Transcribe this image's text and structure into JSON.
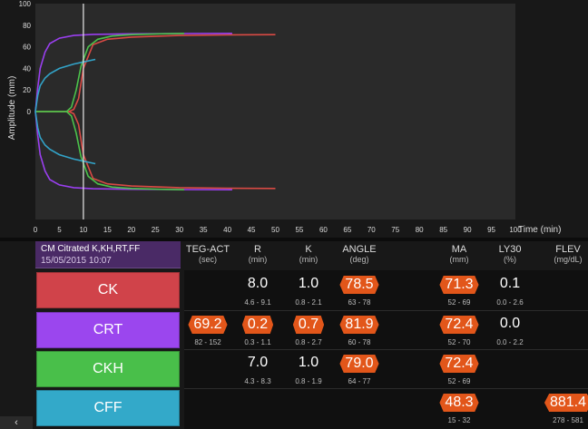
{
  "chart_data": {
    "type": "line",
    "xlabel": "Time (min)",
    "ylabel": "Amplitude (mm)",
    "xlim": [
      0,
      100
    ],
    "ylim": [
      -100,
      100
    ],
    "xticks": [
      0,
      5,
      10,
      15,
      20,
      25,
      30,
      35,
      40,
      45,
      50,
      55,
      60,
      65,
      70,
      75,
      80,
      85,
      90,
      95,
      100
    ],
    "yticks": [
      100,
      80,
      60,
      40,
      20,
      0
    ],
    "cursor_x": 10,
    "series": [
      {
        "color": "#d94a44",
        "points": [
          [
            0,
            0
          ],
          [
            7,
            0
          ],
          [
            8,
            2
          ],
          [
            9,
            12
          ],
          [
            10,
            40
          ],
          [
            12,
            62
          ],
          [
            15,
            67
          ],
          [
            20,
            69
          ],
          [
            30,
            70.5
          ],
          [
            40,
            71
          ],
          [
            50,
            71.3
          ]
        ]
      },
      {
        "color": "#9a3ff0",
        "points": [
          [
            0,
            0
          ],
          [
            0.5,
            22
          ],
          [
            1,
            40
          ],
          [
            2,
            55
          ],
          [
            3,
            63
          ],
          [
            5,
            68
          ],
          [
            8,
            70.5
          ],
          [
            12,
            71.5
          ],
          [
            20,
            72
          ],
          [
            30,
            72.3
          ],
          [
            41,
            72.4
          ]
        ]
      },
      {
        "color": "#4bc24b",
        "points": [
          [
            0,
            0
          ],
          [
            6.5,
            0
          ],
          [
            7.5,
            4
          ],
          [
            8.5,
            20
          ],
          [
            9.5,
            42
          ],
          [
            11,
            60
          ],
          [
            13,
            67
          ],
          [
            16,
            70
          ],
          [
            20,
            71.3
          ],
          [
            26,
            72
          ],
          [
            31,
            72.4
          ]
        ]
      },
      {
        "color": "#32a3c8",
        "points": [
          [
            0,
            0
          ],
          [
            0.5,
            15
          ],
          [
            1,
            24
          ],
          [
            2,
            31
          ],
          [
            3,
            35
          ],
          [
            5,
            40
          ],
          [
            8,
            44
          ],
          [
            10,
            46
          ],
          [
            12.5,
            48.3
          ]
        ]
      }
    ]
  },
  "sample": {
    "title": "CM Citrated K,KH,RT,FF",
    "date": "15/05/2015 10:07"
  },
  "columns": [
    {
      "name": "TEG-ACT",
      "unit": "(sec)"
    },
    {
      "name": "R",
      "unit": "(min)"
    },
    {
      "name": "K",
      "unit": "(min)"
    },
    {
      "name": "ANGLE",
      "unit": "(deg)"
    },
    {
      "name": "MA",
      "unit": "(mm)"
    },
    {
      "name": "LY30",
      "unit": "(%)"
    },
    {
      "name": "FLEV",
      "unit": "(mg/dL)"
    }
  ],
  "rows": [
    {
      "label": "CK",
      "color": "#d0434a",
      "cells": {
        "R": {
          "value": "8.0",
          "range": "4.6 - 9.1"
        },
        "K": {
          "value": "1.0",
          "range": "0.8 - 2.1"
        },
        "ANGLE": {
          "value": "78.5",
          "range": "63 - 78",
          "flag": true
        },
        "MA": {
          "value": "71.3",
          "range": "52 - 69",
          "flag": true
        },
        "LY30": {
          "value": "0.1",
          "range": "0.0 - 2.6"
        }
      }
    },
    {
      "label": "CRT",
      "color": "#9b46ee",
      "cells": {
        "TEG-ACT": {
          "value": "69.2",
          "range": "82 - 152",
          "flag": true
        },
        "R": {
          "value": "0.2",
          "range": "0.3 - 1.1",
          "flag": true
        },
        "K": {
          "value": "0.7",
          "range": "0.8 - 2.7",
          "flag": true
        },
        "ANGLE": {
          "value": "81.9",
          "range": "60 - 78",
          "flag": true
        },
        "MA": {
          "value": "72.4",
          "range": "52 - 70",
          "flag": true
        },
        "LY30": {
          "value": "0.0",
          "range": "0.0 - 2.2"
        }
      }
    },
    {
      "label": "CKH",
      "color": "#49bf4a",
      "cells": {
        "R": {
          "value": "7.0",
          "range": "4.3 - 8.3"
        },
        "K": {
          "value": "1.0",
          "range": "0.8 - 1.9"
        },
        "ANGLE": {
          "value": "79.0",
          "range": "64 - 77",
          "flag": true
        },
        "MA": {
          "value": "72.4",
          "range": "52 - 69",
          "flag": true
        }
      }
    },
    {
      "label": "CFF",
      "color": "#33a9c9",
      "cells": {
        "MA": {
          "value": "48.3",
          "range": "15 - 32",
          "flag": true
        },
        "FLEV": {
          "value": "881.4",
          "range": "278 - 581",
          "flag": true
        }
      }
    }
  ],
  "corner_button": {
    "icon": "chevron-left-icon",
    "label": "‹"
  }
}
